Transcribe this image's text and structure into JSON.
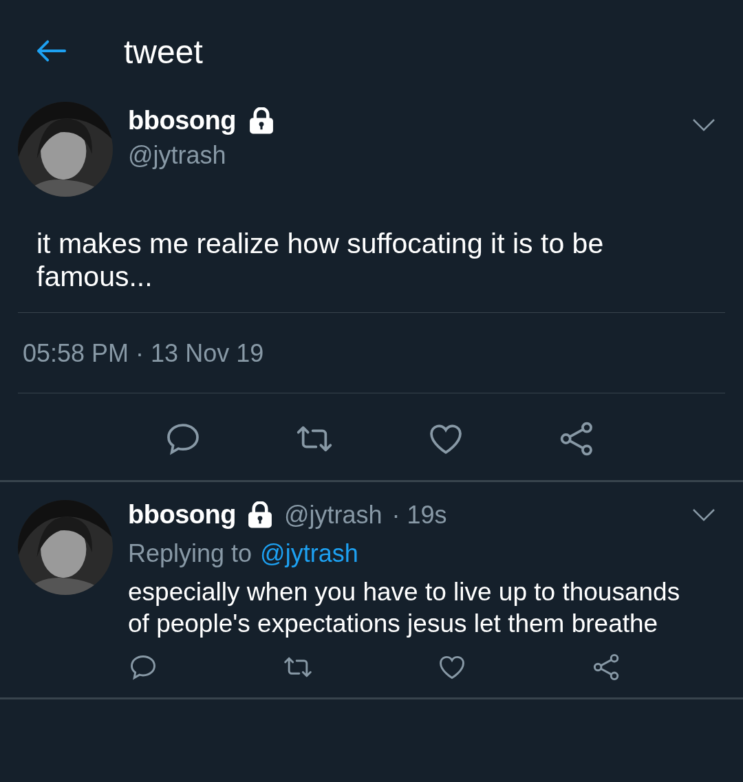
{
  "header": {
    "title": "tweet"
  },
  "tweet": {
    "name": "bbosong",
    "protected": true,
    "handle": "@jytrash",
    "text": "it makes me realize how suffocating it is to be famous...",
    "timestamp": "05:58 PM · 13 Nov 19"
  },
  "replies": [
    {
      "name": "bbosong",
      "protected": true,
      "handle": "@jytrash",
      "time": "· 19s",
      "replying_label": "Replying to",
      "replying_to": "@jytrash",
      "text": "especially when you have to live up to thousands of people's expectations jesus let them breathe"
    }
  ]
}
